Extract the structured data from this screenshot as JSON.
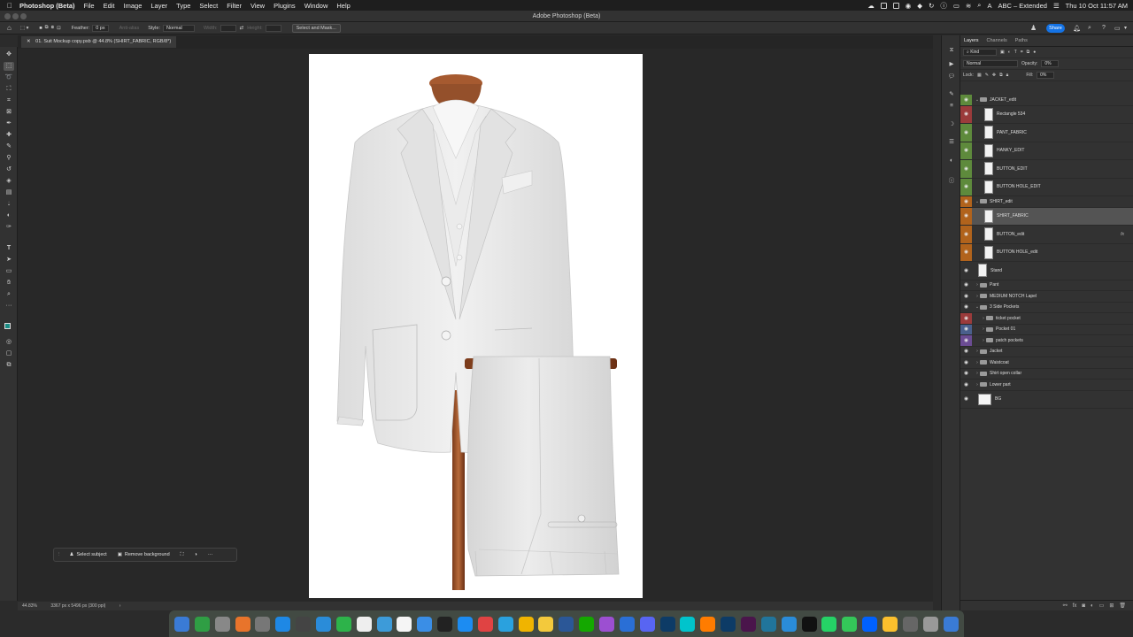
{
  "menubar": {
    "app_name": "Photoshop (Beta)",
    "items": [
      "File",
      "Edit",
      "Image",
      "Layer",
      "Type",
      "Select",
      "Filter",
      "View",
      "Plugins",
      "Window",
      "Help"
    ],
    "input_source": "ABC – Extended",
    "datetime": "Thu 10 Oct  11:57 AM"
  },
  "window": {
    "title": "Adobe Photoshop (Beta)"
  },
  "options": {
    "feather_label": "Feather:",
    "feather_value": "0 px",
    "antialias_label": "Anti-alias",
    "style_label": "Style:",
    "style_value": "Normal",
    "width_label": "Width:",
    "height_label": "Height:",
    "select_mask_label": "Select and Mask...",
    "share_label": "Share"
  },
  "document": {
    "tab_label": "01. Suit Mockup copy.psb @ 44.8% (SHIRT_FABRIC, RGB/8*)"
  },
  "status": {
    "zoom": "44.83%",
    "info": "3367 px x 5496 px (300 ppi)"
  },
  "contextual_bar": {
    "select_subject": "Select subject",
    "remove_background": "Remove background",
    "more": "···"
  },
  "panel": {
    "tabs": [
      "Layers",
      "Channels",
      "Paths"
    ],
    "filter_kind": "Kind",
    "blend_mode": "Normal",
    "opacity_label": "Opacity:",
    "opacity_value": "0%",
    "lock_label": "Lock:",
    "fill_label": "Fill:",
    "fill_value": "0%"
  },
  "layers": [
    {
      "name": "JACKET_edit",
      "type": "group",
      "expanded": true,
      "color": "#5e8a3c",
      "indent": 0,
      "fx": ""
    },
    {
      "name": "Rectangle 534",
      "type": "smart",
      "color": "#9b3b3b",
      "indent": 1,
      "fx": ""
    },
    {
      "name": "PANT_FABRIC",
      "type": "smart",
      "color": "#5e8a3c",
      "indent": 1,
      "fx": ""
    },
    {
      "name": "HANKY_EDIT",
      "type": "smart",
      "color": "#5e8a3c",
      "indent": 1,
      "fx": ""
    },
    {
      "name": "BUTTON_EDIT",
      "type": "smart",
      "color": "#5e8a3c",
      "indent": 1,
      "fx": ""
    },
    {
      "name": "BUTTON HOLE_EDIT",
      "type": "smart",
      "color": "#5e8a3c",
      "indent": 1,
      "fx": ""
    },
    {
      "name": "SHIRT_edit",
      "type": "group",
      "expanded": true,
      "color": "#b1631c",
      "indent": 0,
      "fx": ""
    },
    {
      "name": "SHIRT_FABRIC",
      "type": "smart",
      "color": "#b1631c",
      "indent": 1,
      "selected": true,
      "fx": ""
    },
    {
      "name": "BUTTON_edit",
      "type": "smart",
      "color": "#b1631c",
      "indent": 1,
      "fx": "fx"
    },
    {
      "name": "BUTTON HOLE_edit",
      "type": "smart",
      "color": "#b1631c",
      "indent": 1,
      "fx": ""
    },
    {
      "name": "Stand",
      "type": "smart",
      "color": "",
      "indent": 0,
      "fx": ""
    },
    {
      "name": "Pant",
      "type": "group",
      "expanded": false,
      "color": "",
      "indent": 0,
      "fx": ""
    },
    {
      "name": "MEDIUM NOTCH Lapel",
      "type": "group",
      "expanded": false,
      "color": "",
      "indent": 0,
      "fx": ""
    },
    {
      "name": "3 Side Pockets",
      "type": "group",
      "expanded": true,
      "color": "",
      "indent": 0,
      "fx": ""
    },
    {
      "name": "ticket pocket",
      "type": "group",
      "expanded": false,
      "color": "#9b3b3b",
      "indent": 1,
      "fx": ""
    },
    {
      "name": "Pocket 01",
      "type": "group",
      "expanded": false,
      "color": "#4a5f8c",
      "indent": 1,
      "fx": ""
    },
    {
      "name": "patch pockets",
      "type": "group",
      "expanded": false,
      "color": "#6b4c93",
      "indent": 1,
      "fx": ""
    },
    {
      "name": "Jacket",
      "type": "group",
      "expanded": false,
      "color": "",
      "indent": 0,
      "fx": ""
    },
    {
      "name": "Waistcoat",
      "type": "group",
      "expanded": false,
      "color": "",
      "indent": 0,
      "fx": ""
    },
    {
      "name": "Shirt  open collar",
      "type": "group",
      "expanded": false,
      "color": "",
      "indent": 0,
      "fx": ""
    },
    {
      "name": "Lower part",
      "type": "group",
      "expanded": false,
      "color": "",
      "indent": 0,
      "fx": ""
    },
    {
      "name": "BG",
      "type": "bg",
      "color": "",
      "indent": 0,
      "fx": ""
    }
  ],
  "tools": [
    "move-tool",
    "marquee-tool",
    "lasso-tool",
    "object-select-tool",
    "crop-tool",
    "frame-tool",
    "eyedropper-tool",
    "healing-tool",
    "brush-tool",
    "stamp-tool",
    "history-brush-tool",
    "eraser-tool",
    "gradient-tool",
    "blur-tool",
    "dodge-tool",
    "pen-tool",
    "type-tool",
    "path-select-tool",
    "shape-tool",
    "hand-tool",
    "zoom-tool",
    "more-tool"
  ],
  "colors": {
    "foreground": "#1a8c84",
    "background": "#f1b8b8",
    "accent": "#1473e6"
  },
  "dock_apps": [
    "finder",
    "launchpad",
    "excel",
    "apps",
    "firefox",
    "settings",
    "safari",
    "calculator",
    "photoshop",
    "facetime",
    "reminders",
    "mail",
    "calendar",
    "keynote",
    "appletv",
    "app-store",
    "chrome",
    "skype",
    "pages",
    "notes",
    "word",
    "upwork",
    "podcasts",
    "mail2",
    "discord",
    "photoshop2",
    "canva",
    "illustrator",
    "photoshop3",
    "slack",
    "wordpress",
    "safari2",
    "capcut",
    "whatsapp",
    "messages",
    "dropbox",
    "notes2",
    "preview",
    "trash"
  ]
}
